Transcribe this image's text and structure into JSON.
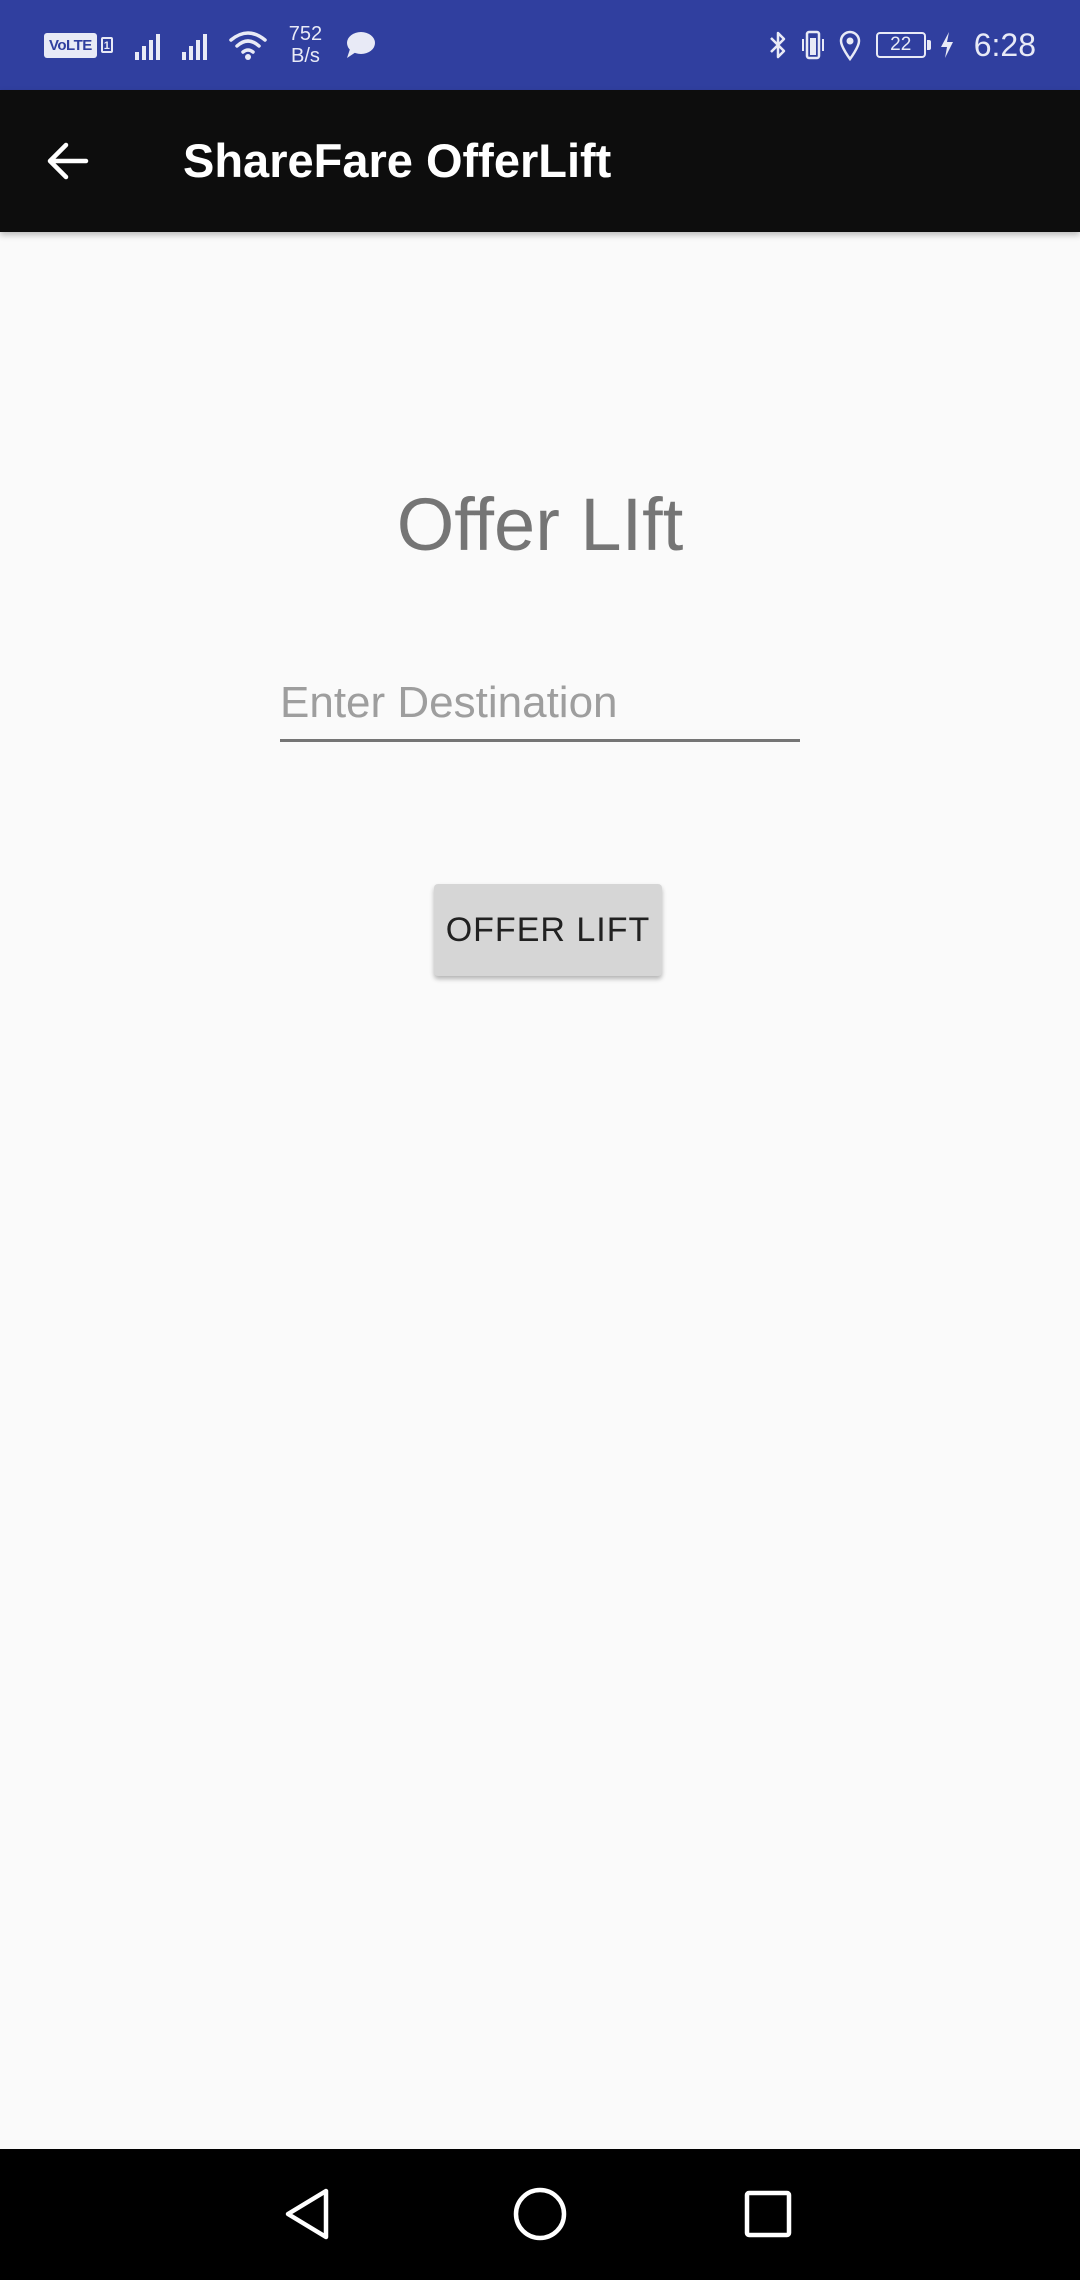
{
  "status_bar": {
    "volte_label": "VoLTE",
    "sim_index": "1",
    "net_speed_value": "752",
    "net_speed_unit": "B/s",
    "battery_level": "22",
    "time": "6:28",
    "icons": [
      "volte-icon",
      "signal-icon",
      "signal-icon",
      "wifi-icon",
      "message-icon",
      "bluetooth-icon",
      "vibrate-icon",
      "location-icon",
      "battery-icon",
      "charging-icon"
    ],
    "background_color": "#303f9f"
  },
  "app_bar": {
    "title": "ShareFare OfferLift",
    "back_icon": "arrow-left-icon",
    "background_color": "#0d0d0d"
  },
  "main": {
    "heading": "Offer LIft",
    "destination_input": {
      "value": "",
      "placeholder": "Enter Destination"
    },
    "offer_button_label": "OFFER LIFT"
  },
  "nav_bar": {
    "icons": [
      "back-triangle-icon",
      "home-circle-icon",
      "recents-square-icon"
    ]
  }
}
